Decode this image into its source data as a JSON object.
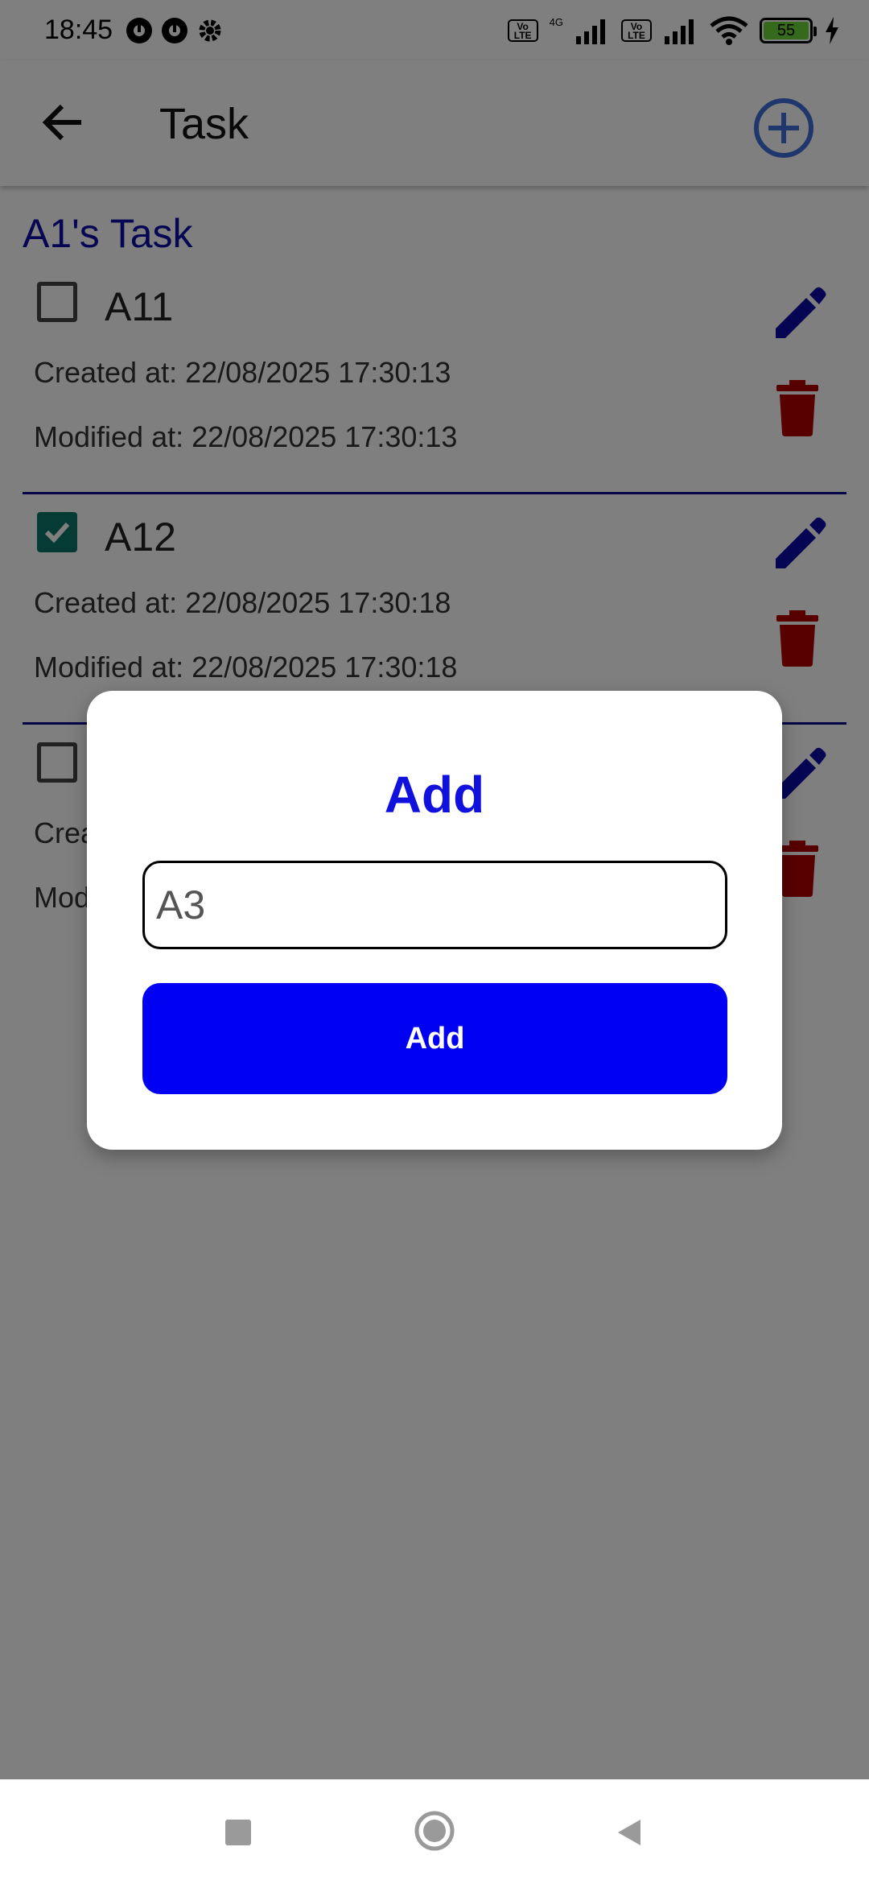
{
  "status_bar": {
    "time": "18:45",
    "volte_1": "Vo LTE",
    "network": "4G",
    "volte_2": "Vo LTE",
    "battery": "55",
    "icons": [
      "notification-icon",
      "notification-icon",
      "settings-icon",
      "signal-icon",
      "wifi-icon",
      "battery-icon",
      "charging-icon"
    ]
  },
  "app_bar": {
    "title": "Task",
    "back_icon": "arrow-left-icon",
    "add_icon": "add-circle-icon"
  },
  "task_list": {
    "title": "A1's Task",
    "items": [
      {
        "name": "A11",
        "checked": false,
        "created": "Created at: 22/08/2025 17:30:13",
        "modified": "Modified at: 22/08/2025 17:30:13"
      },
      {
        "name": "A12",
        "checked": true,
        "created": "Created at: 22/08/2025 17:30:18",
        "modified": "Modified at: 22/08/2025 17:30:18"
      },
      {
        "name": "",
        "checked": false,
        "created": "Crea",
        "modified": "Mod"
      }
    ]
  },
  "dialog": {
    "title": "Add",
    "input_value": "A3",
    "button_label": "Add"
  },
  "colors": {
    "accent_blue": "#0000f2",
    "title_blue": "#1111dd",
    "list_title": "#0a0aa6",
    "edit_icon": "#0a0aa6",
    "delete_icon": "#b00000",
    "checkbox_checked": "#0b7768",
    "scrim": "rgba(0,0,0,0.5)"
  },
  "nav_bar": {
    "icons": [
      "recent-apps-icon",
      "home-icon",
      "back-icon"
    ]
  }
}
